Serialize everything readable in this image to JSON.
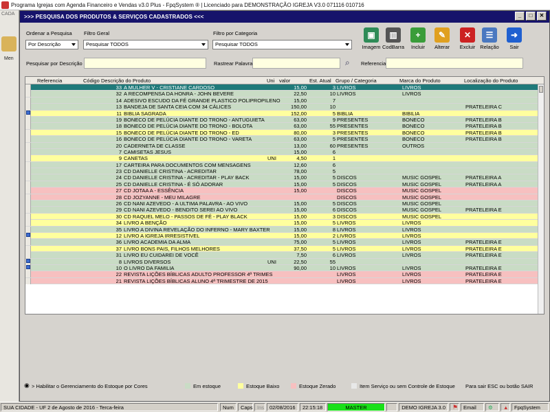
{
  "window": {
    "title": "Programa Igrejas com Agenda Financeiro e Vendas v3.0 Plus - FpqSystem ® | Licenciado para  DEMONSTRAÇÃO IGREJA V3.0 071116 010716"
  },
  "background_app": {
    "label_top": "CADA",
    "label_btn": "Men"
  },
  "dialog": {
    "title": ">>>  PESQUISA DOS PRODUTOS & SERVIÇOS CADASTRADOS  <<<",
    "ordenar_label": "Ordenar a Pesquisa",
    "ordenar_value": "Por Descrição",
    "filtro_geral_label": "Filtro Geral",
    "filtro_geral_value": "Pesquisar TODOS",
    "filtro_cat_label": "Filtro por Categoria",
    "filtro_cat_value": "Pesquisar TODOS",
    "pesq_desc_label": "Pesquisar por Descrição",
    "rastrear_label": "Rastrear Palavras",
    "referencia_label": "Referencia"
  },
  "toolbar": [
    {
      "name": "imagem",
      "label": "Imagem",
      "icon": "image-icon",
      "color": "#2e8b57",
      "glyph": "▣"
    },
    {
      "name": "codbarra",
      "label": "CodBarra",
      "icon": "barcode-icon",
      "color": "#555555",
      "glyph": "▥"
    },
    {
      "name": "incluir",
      "label": "Incluir",
      "icon": "add-icon",
      "color": "#3a9d3a",
      "glyph": "+"
    },
    {
      "name": "alterar",
      "label": "Alterar",
      "icon": "edit-icon",
      "color": "#e0a020",
      "glyph": "✎"
    },
    {
      "name": "excluir",
      "label": "Excluir",
      "icon": "delete-icon",
      "color": "#cc2222",
      "glyph": "✕"
    },
    {
      "name": "relacao",
      "label": "Relação",
      "icon": "report-icon",
      "color": "#4a78c0",
      "glyph": "☰"
    },
    {
      "name": "sair",
      "label": "Sair",
      "icon": "exit-icon",
      "color": "#2060d0",
      "glyph": "➜"
    }
  ],
  "columns": {
    "ref": "Referencia",
    "cod": "Código",
    "desc": "Descrição do Produto",
    "uni": "Uni",
    "val": "valor",
    "est": "Est. Atual",
    "grp": "Grupo / Categoria",
    "mar": "Marca do Produto",
    "loc": "Localização do Produto"
  },
  "colors": {
    "selected": "#1f7a7a",
    "green": "#c9dcc5",
    "yellow": "#ffff9e",
    "red": "#f7c0c0",
    "grey": "#e8e8e8"
  },
  "rows": [
    {
      "ind": false,
      "cod": "33",
      "desc": "A MULHER V - CRISTIANE CARDOSO",
      "uni": "",
      "val": "15,00",
      "est": "3",
      "grp": "LIVROS",
      "mar": "LIVROS",
      "loc": "",
      "color": "selected"
    },
    {
      "ind": false,
      "cod": "32",
      "desc": "A RECOMPENSA DA HONRA - JOHN BEVERE",
      "uni": "",
      "val": "22,50",
      "est": "10",
      "grp": "LIVROS",
      "mar": "LIVROS",
      "loc": "",
      "color": "green"
    },
    {
      "ind": false,
      "cod": "14",
      "desc": "ADESIVO ESCUDO DA FÉ GRANDE PLASTICO POLIPROPILENO",
      "uni": "",
      "val": "15,00",
      "est": "7",
      "grp": "",
      "mar": "",
      "loc": "",
      "color": "green"
    },
    {
      "ind": false,
      "cod": "13",
      "desc": "BANDEJA DE SANTA CEIA COM 34 CÁLICES",
      "uni": "",
      "val": "150,00",
      "est": "10",
      "grp": "",
      "mar": "",
      "loc": "PRATELEIRA C",
      "color": "green"
    },
    {
      "ind": true,
      "cod": "11",
      "desc": "BIBLIA SAGRADA",
      "uni": "",
      "val": "152,00",
      "est": "5",
      "grp": "BIBLIA",
      "mar": "BIBILIA",
      "loc": "",
      "color": "yellow"
    },
    {
      "ind": false,
      "cod": "19",
      "desc": "BONECO DE PELÚCIA DIANTE DO TRONO - ANTUGUIETA",
      "uni": "",
      "val": "63,00",
      "est": "9",
      "grp": "PRESENTES",
      "mar": "BONECO",
      "loc": "PRATELEIRA B",
      "color": "green"
    },
    {
      "ind": false,
      "cod": "18",
      "desc": "BONECO DE PELÚCIA DIANTE DO TRONO - BOLOTA",
      "uni": "",
      "val": "63,00",
      "est": "55",
      "grp": "PRESENTES",
      "mar": "BONECO",
      "loc": "PRATELEIRA B",
      "color": "green"
    },
    {
      "ind": false,
      "cod": "15",
      "desc": "BONECO DE PELÚCIA DIANTE DO TRONO - ED",
      "uni": "",
      "val": "80,00",
      "est": "3",
      "grp": "PRESENTES",
      "mar": "BONECO",
      "loc": "PRATELEIRA B",
      "color": "yellow"
    },
    {
      "ind": false,
      "cod": "16",
      "desc": "BONECO DE PELÚCIA DIANTE DO TRONO - VARETA",
      "uni": "",
      "val": "63,00",
      "est": "5",
      "grp": "PRESENTES",
      "mar": "BONECO",
      "loc": "PRATELEIRA B",
      "color": "green"
    },
    {
      "ind": false,
      "cod": "20",
      "desc": "CADERNETA DE CLASSE",
      "uni": "",
      "val": "13,00",
      "est": "60",
      "grp": "PRESENTES",
      "mar": "OUTROS",
      "loc": "",
      "color": "green"
    },
    {
      "ind": false,
      "cod": "7",
      "desc": "CAMISETAS JESUS",
      "uni": "",
      "val": "15,00",
      "est": "6",
      "grp": "",
      "mar": "",
      "loc": "",
      "color": "green"
    },
    {
      "ind": false,
      "cod": "9",
      "desc": "CANETAS",
      "uni": "UNI",
      "val": "4,50",
      "est": "1",
      "grp": "",
      "mar": "",
      "loc": "",
      "color": "yellow"
    },
    {
      "ind": false,
      "cod": "17",
      "desc": "CARTEIRA PARA DOCUMENTOS COM MENSAGENS",
      "uni": "",
      "val": "12,60",
      "est": "6",
      "grp": "",
      "mar": "",
      "loc": "",
      "color": "green"
    },
    {
      "ind": false,
      "cod": "23",
      "desc": "CD DANIELLE CRISTINA - ACREDITAR",
      "uni": "",
      "val": "78,00",
      "est": "5",
      "grp": "",
      "mar": "",
      "loc": "",
      "color": "green"
    },
    {
      "ind": false,
      "cod": "24",
      "desc": "CD DANIELLE CRISTINA - ACREDITAR - PLAY BACK",
      "uni": "",
      "val": "15,00",
      "est": "5",
      "grp": "DISCOS",
      "mar": "MUSIC GOSPEL",
      "loc": "PRATELEIRA A",
      "color": "green"
    },
    {
      "ind": false,
      "cod": "25",
      "desc": "CD DANIELLE CRISTINA - É SÓ ADORAR",
      "uni": "",
      "val": "15,00",
      "est": "5",
      "grp": "DISCOS",
      "mar": "MUSIC GOSPEL",
      "loc": "PRATELEIRA A",
      "color": "green"
    },
    {
      "ind": false,
      "cod": "27",
      "desc": "CD JOTAA A - ESSÊNCIA",
      "uni": "",
      "val": "15,00",
      "est": "",
      "grp": "DISCOS",
      "mar": "MUSIC GOSPEL",
      "loc": "",
      "color": "red"
    },
    {
      "ind": false,
      "cod": "28",
      "desc": "CD JOZYANNE - MEU MILAGRE",
      "uni": "",
      "val": "",
      "est": "",
      "grp": "DISCOS",
      "mar": "MUSIC GOSPEL",
      "loc": "",
      "color": "red"
    },
    {
      "ind": false,
      "cod": "26",
      "desc": "CD NANI AZEVEDO - A ULTIMA PALAVRA - AO VIVO",
      "uni": "",
      "val": "15,00",
      "est": "5",
      "grp": "DISCOS",
      "mar": "MUSIC GOSPEL",
      "loc": "",
      "color": "green"
    },
    {
      "ind": false,
      "cod": "29",
      "desc": "CD NANI AZEVEDO - BENDITO SEREI AO VIVO",
      "uni": "",
      "val": "15,00",
      "est": "6",
      "grp": "DISCOS",
      "mar": "MUSIC GOSPEL",
      "loc": "PRATELEIRA E",
      "color": "green"
    },
    {
      "ind": false,
      "cod": "30",
      "desc": "CD RAQUEL MELO - PASSOS DE FÉ - PLAY BLACK",
      "uni": "",
      "val": "15,00",
      "est": "3",
      "grp": "DISCOS",
      "mar": "MUSIC GOSPEL",
      "loc": "",
      "color": "yellow"
    },
    {
      "ind": false,
      "cod": "34",
      "desc": "LIVRO A BENÇÃO",
      "uni": "",
      "val": "15,00",
      "est": "5",
      "grp": "LIVROS",
      "mar": "LIVROS",
      "loc": "",
      "color": "yellow"
    },
    {
      "ind": false,
      "cod": "35",
      "desc": "LIVRO A DIVINA REVELAÇÃO DO INFERNO - MARY BAXTER",
      "uni": "",
      "val": "15,00",
      "est": "8",
      "grp": "LIVROS",
      "mar": "LIVROS",
      "loc": "",
      "color": "green"
    },
    {
      "ind": true,
      "cod": "12",
      "desc": "LIVRO A IGREJA IRRESISTIVEL",
      "uni": "",
      "val": "15,00",
      "est": "2",
      "grp": "LIVROS",
      "mar": "LIVROS",
      "loc": "",
      "color": "yellow"
    },
    {
      "ind": false,
      "cod": "36",
      "desc": "LIVRO ACADEMIA DA ALMA",
      "uni": "",
      "val": "75,00",
      "est": "5",
      "grp": "LIVROS",
      "mar": "LIVROS",
      "loc": "PRATELEIRA E",
      "color": "green"
    },
    {
      "ind": false,
      "cod": "37",
      "desc": "LIVRO BONS PAIS, FILHOS MELHORES",
      "uni": "",
      "val": "37,50",
      "est": "5",
      "grp": "LIVROS",
      "mar": "LIVROS",
      "loc": "PRATELEIRA E",
      "color": "yellow"
    },
    {
      "ind": false,
      "cod": "31",
      "desc": "LIVRO EU CUIDAREI DE VOCÊ",
      "uni": "",
      "val": "7,50",
      "est": "6",
      "grp": "LIVROS",
      "mar": "LIVROS",
      "loc": "PRATELEIRA E",
      "color": "green"
    },
    {
      "ind": true,
      "cod": "8",
      "desc": "LIVROS DIVERSOS",
      "uni": "UNI",
      "val": "22,50",
      "est": "55",
      "grp": "",
      "mar": "",
      "loc": "",
      "color": "green"
    },
    {
      "ind": true,
      "cod": "10",
      "desc": "O LIVRO DA FAMILIA",
      "uni": "",
      "val": "90,00",
      "est": "10",
      "grp": "LIVROS",
      "mar": "LIVROS",
      "loc": "PRATELEIRA E",
      "color": "green"
    },
    {
      "ind": false,
      "cod": "22",
      "desc": "REVISTA LIÇÕES BÍBLICAS ADULTO PROFESSOR 4ª TRIMES",
      "uni": "",
      "val": "",
      "est": "",
      "grp": "LIVROS",
      "mar": "LIVROS",
      "loc": "PRATELEIRA E",
      "color": "red"
    },
    {
      "ind": false,
      "cod": "21",
      "desc": "REVISTA LIÇÕES BÍBLICAS ALUNO 4ª TRIMESTRE DE 2015",
      "uni": "",
      "val": "",
      "est": "",
      "grp": "LIVROS",
      "mar": "LIVROS",
      "loc": "PRATELEIRA E",
      "color": "red"
    }
  ],
  "legend": {
    "habilitar": "> Habilitar o Gerenciamento do Estoque por Cores",
    "em_estoque": "Em estoque",
    "estoque_baixo": "Estoque Baixo",
    "estoque_zerado": "Estoque Zerado",
    "item_servico": "Item Serviço ou sem Controle de Estoque",
    "sair_hint": "Para sair ESC ou botão SAIR"
  },
  "statusbar": {
    "cidade": "SUA CIDADE - UF  2 de Agosto de 2016 - Terca-feira",
    "num": "Num",
    "caps": "Caps",
    "ins": "Ins",
    "date": "02/08/2016",
    "time": "22:15:18",
    "master": "MASTER",
    "igreja": "DEMO IGREJA 3.0",
    "email": "Email",
    "fpq": "FpqSystem"
  }
}
